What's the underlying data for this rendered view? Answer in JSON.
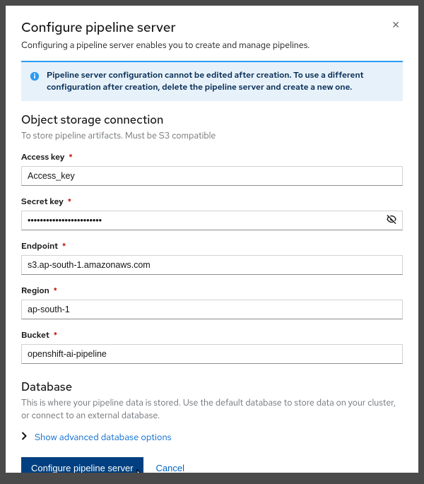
{
  "modal": {
    "title": "Configure pipeline server",
    "subtitle": "Configuring a pipeline server enables you to create and manage pipelines."
  },
  "alert": {
    "message": "Pipeline server configuration cannot be edited after creation. To use a different configuration after creation, delete the pipeline server and create a new one."
  },
  "storage": {
    "title": "Object storage connection",
    "subtitle": "To store pipeline artifacts. Must be S3 compatible",
    "access_key_label": "Access key",
    "access_key_value": "Access_key",
    "secret_key_label": "Secret key",
    "secret_key_value": "••••••••••••••••••••••••",
    "endpoint_label": "Endpoint",
    "endpoint_value": "s3.ap-south-1.amazonaws.com",
    "region_label": "Region",
    "region_value": "ap-south-1",
    "bucket_label": "Bucket",
    "bucket_value": "openshift-ai-pipeline"
  },
  "database": {
    "title": "Database",
    "subtitle": "This is where your pipeline data is stored. Use the default database to store data on your cluster, or connect to an external database.",
    "expand_label": "Show advanced database options"
  },
  "footer": {
    "primary_label": "Configure pipeline server",
    "cancel_label": "Cancel"
  },
  "required_mark": "*"
}
